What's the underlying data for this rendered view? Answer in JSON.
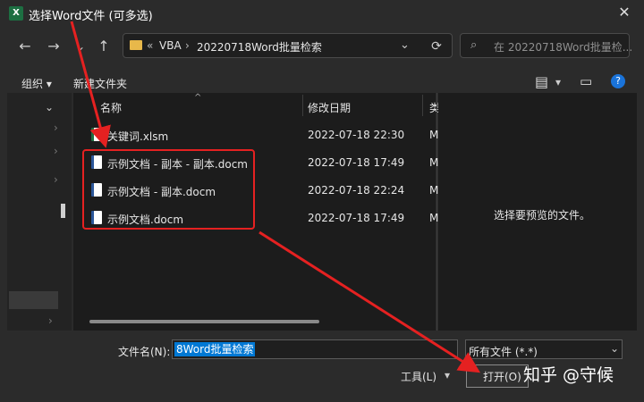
{
  "window": {
    "title": "选择Word文件 (可多选)",
    "app_icon": "excel-icon",
    "close_glyph": "✕"
  },
  "nav": {
    "back": "←",
    "forward": "→",
    "dropdown": "⌄",
    "up": "↑",
    "refresh": "⟳"
  },
  "address": {
    "sep1": "«",
    "seg1": "VBA",
    "sep2": "›",
    "seg2": "20220718Word批量检索",
    "dropdown": "⌄"
  },
  "search": {
    "placeholder": "在 20220718Word批量检..."
  },
  "toolbar": {
    "organize": "组织 ▾",
    "new_folder": "新建文件夹",
    "view_glyph": "▤",
    "view_dd": "▾",
    "pane_glyph": "▭",
    "help": "?"
  },
  "columns": {
    "name": "名称",
    "date": "修改日期",
    "type": "类"
  },
  "files": [
    {
      "name": "关键词.xlsm",
      "date": "2022-07-18 22:30",
      "type": "M"
    },
    {
      "name": "示例文档 - 副本 - 副本.docm",
      "date": "2022-07-18 17:49",
      "type": "M"
    },
    {
      "name": "示例文档 - 副本.docm",
      "date": "2022-07-18 22:24",
      "type": "M"
    },
    {
      "name": "示例文档.docm",
      "date": "2022-07-18 17:49",
      "type": "M"
    }
  ],
  "preview": {
    "text": "选择要预览的文件。"
  },
  "bottom": {
    "filename_label": "文件名(N):",
    "filename_value": "8Word批量检索",
    "filetype": "所有文件 (*.*)",
    "tools": "工具(L)",
    "tools_dd": "▾",
    "open": "打开(O)",
    "watermark": "知乎 @守候"
  },
  "colors": {
    "highlight_red": "#e52121",
    "selection": "#0078d4"
  }
}
